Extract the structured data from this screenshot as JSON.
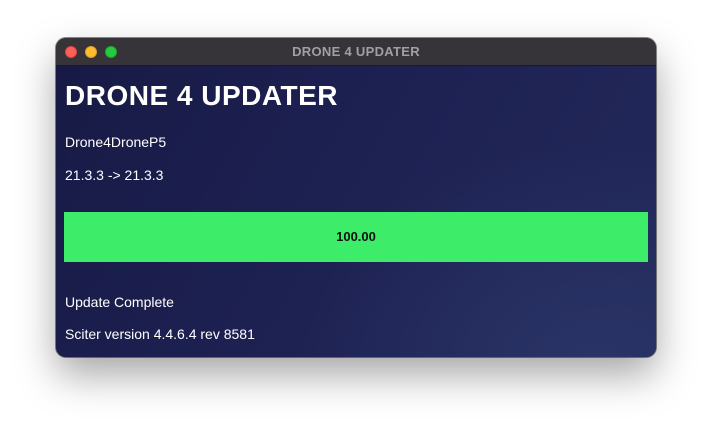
{
  "window": {
    "title": "DRONE 4 UPDATER"
  },
  "app": {
    "title": "DRONE 4 UPDATER",
    "device_name": "Drone4DroneP5",
    "version_change": "21.3.3 -> 21.3.3",
    "progress": {
      "value": 100,
      "label": "100.00",
      "fill_color": "#3ded6a"
    },
    "status": "Update Complete",
    "sciter_version": "Sciter version 4.4.6.4 rev 8581"
  },
  "colors": {
    "background": "#1c1f4a",
    "titlebar": "#363438",
    "text": "#ffffff"
  },
  "icons": {
    "close": "close-icon",
    "minimize": "minimize-icon",
    "zoom": "zoom-icon"
  }
}
